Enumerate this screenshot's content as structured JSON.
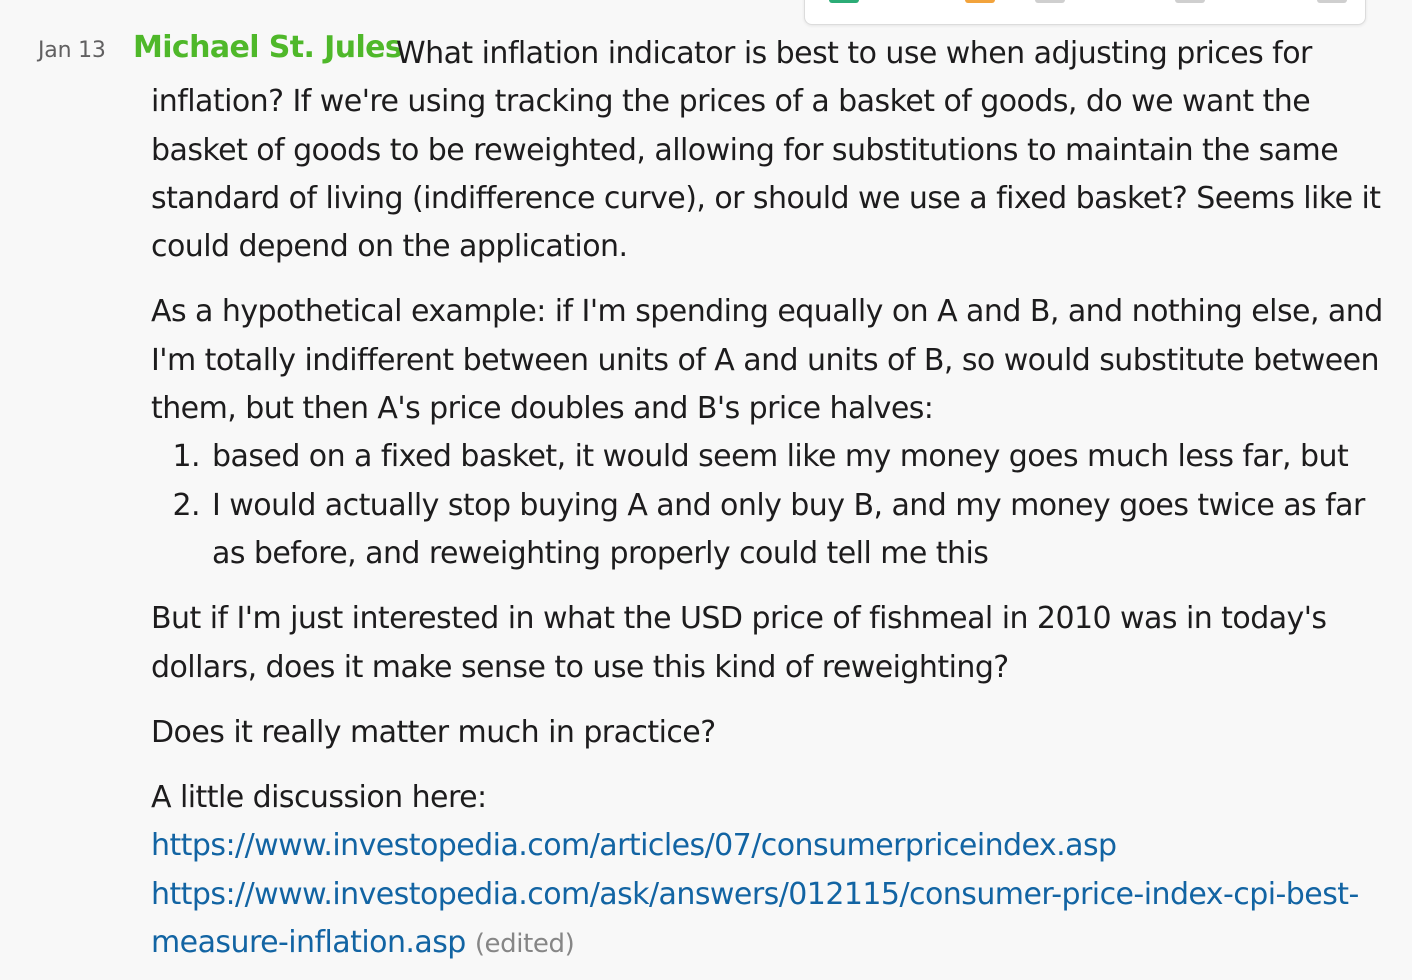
{
  "message": {
    "timestamp": "Jan 13",
    "author": "Michael St. Jules",
    "first_line": "What inflation indicator is best to use when adjusting prices for",
    "para1_rest": "inflation? If we're using tracking the prices of a basket of goods, do we want the basket of goods to be reweighted, allowing for substitutions to maintain the same standard of living (indifference curve), or should we use a fixed basket? Seems like it could depend on the application.",
    "para2": "As a hypothetical example: if I'm spending equally on A and B, and nothing else, and I'm totally indifferent between units of A and units of B, so would substitute between them, but then A's price doubles and B's price halves:",
    "list": [
      {
        "num": "1.",
        "text": "based on a fixed basket, it would seem like my money goes much less far, but"
      },
      {
        "num": "2.",
        "text": "I would actually stop buying A and only buy B, and my money goes twice as far as before, and reweighting properly could tell me this"
      }
    ],
    "para3": "But if I'm just interested in what the USD price of fishmeal in 2010 was in today's dollars, does it make sense to use this kind of reweighting?",
    "para4": "Does it really matter much in practice?",
    "para5_intro": "A little discussion here:",
    "link1": "https://www.investopedia.com/articles/07/consumerpriceindex.asp",
    "link2": "https://www.investopedia.com/ask/answers/012115/consumer-price-index-cpi-best-measure-inflation.asp",
    "edited_label": "(edited)"
  },
  "toolbar_icons": [
    "emoji-reaction-icon",
    "reaction-icon",
    "reply-icon",
    "share-icon",
    "more-icon"
  ],
  "colors": {
    "author": "#4fb82a",
    "link": "#1264a3",
    "background": "#f8f8f8",
    "timestamp": "#616061"
  }
}
